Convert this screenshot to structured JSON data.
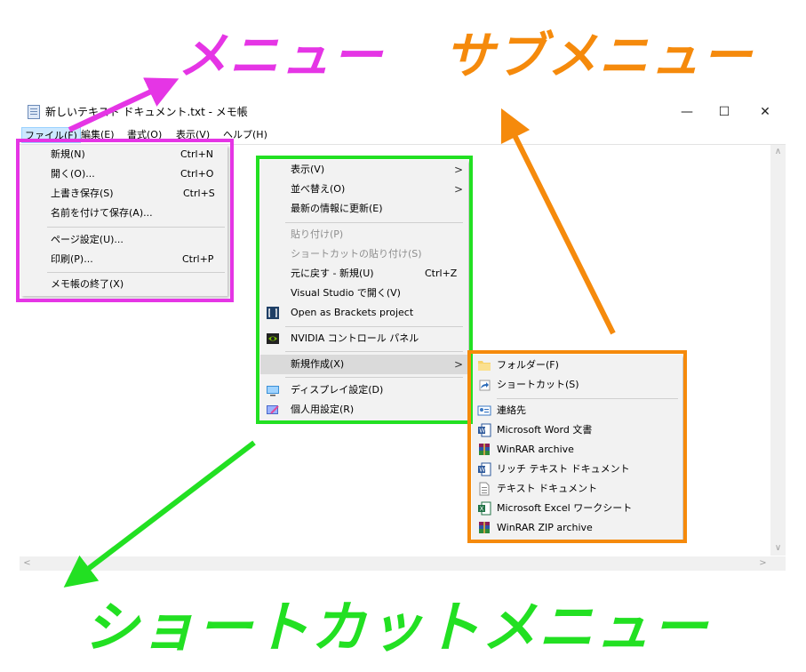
{
  "window": {
    "title": "新しいテキスト ドキュメント.txt - メモ帳",
    "minimize_glyph": "—",
    "maximize_glyph": "☐",
    "close_glyph": "✕"
  },
  "menubar": [
    "ファイル(F)",
    "編集(E)",
    "書式(O)",
    "表示(V)",
    "ヘルプ(H)"
  ],
  "file_menu": [
    {
      "label": "新規(N)",
      "accel": "Ctrl+N"
    },
    {
      "label": "開く(O)...",
      "accel": "Ctrl+O"
    },
    {
      "label": "上書き保存(S)",
      "accel": "Ctrl+S"
    },
    {
      "label": "名前を付けて保存(A)...",
      "accel": ""
    },
    {
      "label": "ページ設定(U)...",
      "accel": ""
    },
    {
      "label": "印刷(P)...",
      "accel": "Ctrl+P"
    },
    {
      "label": "メモ帳の終了(X)",
      "accel": ""
    }
  ],
  "context_menu": [
    {
      "label": "表示(V)",
      "submenu": true
    },
    {
      "label": "並べ替え(O)",
      "submenu": true
    },
    {
      "label": "最新の情報に更新(E)"
    },
    {
      "label": "貼り付け(P)",
      "disabled": true
    },
    {
      "label": "ショートカットの貼り付け(S)",
      "disabled": true
    },
    {
      "label": "元に戻す - 新規(U)",
      "accel": "Ctrl+Z"
    },
    {
      "label": "Visual Studio で開く(V)"
    },
    {
      "label": "Open as Brackets project",
      "icon": "brackets-icon"
    },
    {
      "label": "NVIDIA コントロール パネル",
      "icon": "nvidia-icon"
    },
    {
      "label": "新規作成(X)",
      "submenu": true,
      "highlighted": true
    },
    {
      "label": "ディスプレイ設定(D)",
      "icon": "display-icon"
    },
    {
      "label": "個人用設定(R)",
      "icon": "personalize-icon"
    }
  ],
  "sub_menu": [
    {
      "label": "フォルダー(F)",
      "icon": "folder-icon"
    },
    {
      "label": "ショートカット(S)",
      "icon": "shortcut-icon"
    },
    {
      "label": "連絡先",
      "icon": "contact-icon"
    },
    {
      "label": "Microsoft Word 文書",
      "icon": "word-icon"
    },
    {
      "label": "WinRAR archive",
      "icon": "winrar-icon"
    },
    {
      "label": "リッチ テキスト ドキュメント",
      "icon": "rtf-icon"
    },
    {
      "label": "テキスト ドキュメント",
      "icon": "text-doc-icon"
    },
    {
      "label": "Microsoft Excel ワークシート",
      "icon": "excel-icon"
    },
    {
      "label": "WinRAR ZIP archive",
      "icon": "winrar-zip-icon"
    }
  ],
  "annotations": {
    "menu": "メニュー",
    "submenu": "サブメニュー",
    "shortcut_menu": "ショートカットメニュー",
    "colors": {
      "menu": "#e535e5",
      "submenu": "#f58a0c",
      "shortcut_menu": "#22e022"
    }
  }
}
